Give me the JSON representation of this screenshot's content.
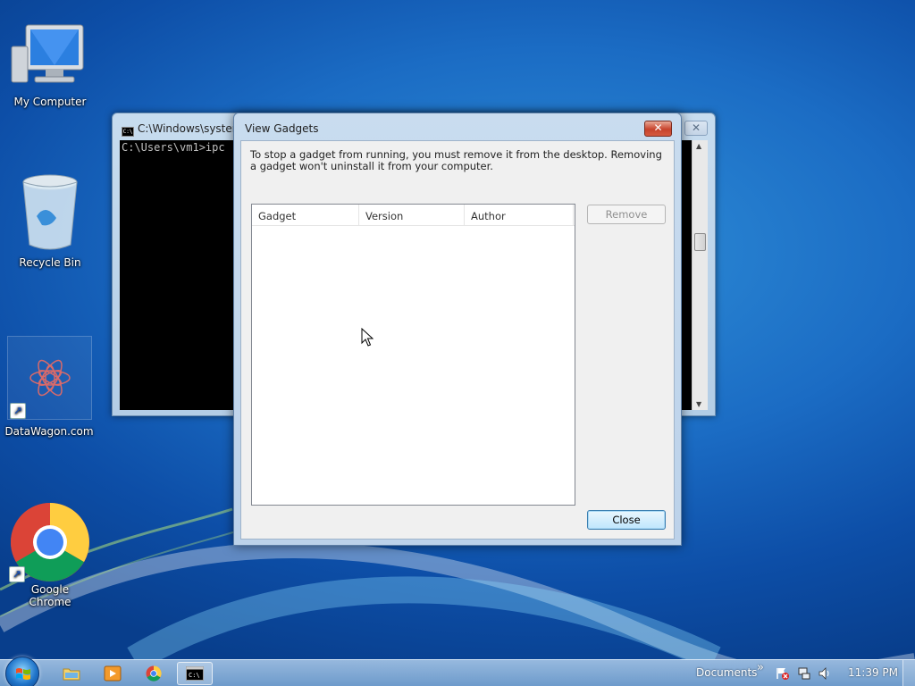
{
  "desktop": {
    "icons": [
      {
        "label": "My Computer"
      },
      {
        "label": "Recycle Bin"
      },
      {
        "label": "DataWagon.com"
      },
      {
        "label": "Google Chrome"
      }
    ]
  },
  "cmd_window": {
    "title": "C:\\Windows\\system",
    "content": "C:\\Users\\vm1>ipc",
    "close_label": "✕"
  },
  "dialog": {
    "title": "View Gadgets",
    "close_label": "✕",
    "instructions": "To stop a gadget from running, you must remove it from the desktop. Removing a gadget won't uninstall it from your computer.",
    "columns": [
      "Gadget",
      "Version",
      "Author"
    ],
    "rows": [],
    "remove_label": "Remove",
    "close_button_label": "Close"
  },
  "taskbar": {
    "documents_label": "Documents",
    "chevron": "»",
    "clock": "11:39 PM",
    "apps": [
      "explorer-icon",
      "media-player-icon",
      "chrome-icon",
      "cmd-icon"
    ]
  },
  "colors": {
    "accent": "#1b6cc4",
    "close_red": "#c7432c"
  }
}
